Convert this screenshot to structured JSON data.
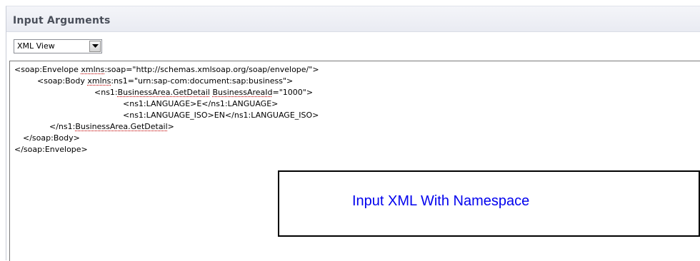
{
  "panel": {
    "title": "Input Arguments"
  },
  "toolbar": {
    "view_select": {
      "selected": "XML View",
      "button_icon": "dropdown-arrow-icon"
    }
  },
  "xml": {
    "lines": [
      {
        "before": "<soap:Envelope ",
        "squiggle": "xmlns",
        "after": ":soap=\"http://schemas.xmlsoap.org/soap/envelope/\">"
      },
      {
        "before": "<soap:Body ",
        "squiggle": "xmlns",
        "after": ":ns1=\"urn:sap-com:document:sap:business\">"
      },
      {
        "before": "<ns1:",
        "squiggle": "BusinessArea.GetDetail",
        "mid": " ",
        "squiggle2": "BusinessAreaId",
        "after": "=\"1000\">"
      },
      {
        "before": "<ns1:LANGUAGE>E</ns1:LANGUAGE>",
        "squiggle": "",
        "after": ""
      },
      {
        "before": "<ns1:LANGUAGE_ISO>EN</ns1:LANGUAGE_ISO>",
        "squiggle": "",
        "after": ""
      },
      {
        "before": "</ns1:",
        "squiggle": "BusinessArea.GetDetail",
        "after": ">"
      },
      {
        "before": "</soap:Body>",
        "squiggle": "",
        "after": ""
      },
      {
        "before": "</soap:Envelope>",
        "squiggle": "",
        "after": ""
      }
    ]
  },
  "callout": {
    "text": "Input XML With Namespace",
    "text_color": "#0000ee"
  }
}
